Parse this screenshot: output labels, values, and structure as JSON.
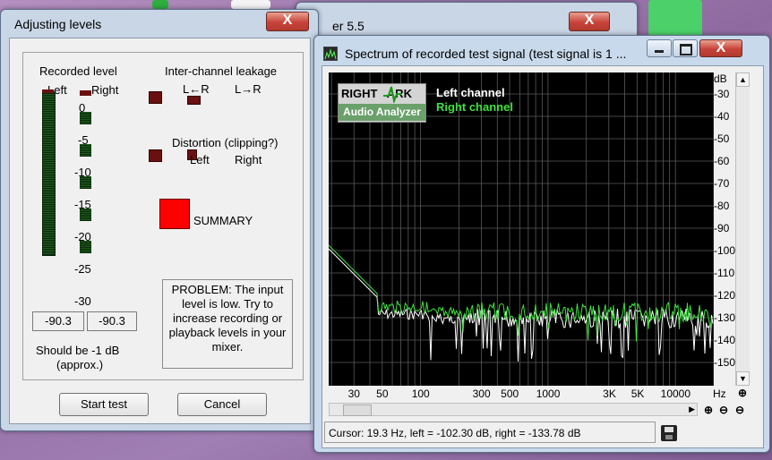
{
  "left_window": {
    "title": "Adjusting levels",
    "close_label": "X",
    "recorded_level": "Recorded level",
    "left": "Left",
    "right": "Right",
    "scale": [
      "0",
      "-5",
      "-10",
      "-15",
      "-20",
      "-25",
      "-30"
    ],
    "leakage_title": "Inter-channel leakage",
    "leakage_lr": "L←R",
    "leakage_rl": "L→R",
    "distortion_title": "Distortion (clipping?)",
    "dist_left": "Left",
    "dist_right": "Right",
    "summary": "SUMMARY",
    "summary_color": "#ff0000",
    "left_value": "-90.3",
    "right_value": "-90.3",
    "should_be": "Should be  -1 dB",
    "approx": "(approx.)",
    "problem": "PROBLEM: The input level is low. Try to increase recording or playback levels in your mixer.",
    "start_btn": "Start test",
    "cancel_btn": "Cancel"
  },
  "behind": {
    "partial_title": "er 5.5",
    "close_label": "X"
  },
  "spectrum_window": {
    "title": "Spectrum of recorded test signal (test signal is 1 ...",
    "close_label": "X",
    "logo_top": "RIGHT   ARK",
    "logo_bottom": "Audio Analyzer",
    "left_channel": "Left channel",
    "right_channel": "Right channel",
    "left_color": "#ffffff",
    "right_color": "#40e040",
    "db_unit": "dB",
    "db_ticks": [
      "-30",
      "-40",
      "-50",
      "-60",
      "-70",
      "-80",
      "-90",
      "-100",
      "-110",
      "-120",
      "-130",
      "-140",
      "-150"
    ],
    "hz_ticks": [
      "30",
      "50",
      "100",
      "300",
      "500",
      "1000",
      "3K",
      "5K",
      "10000"
    ],
    "hz_unit": "Hz",
    "cursor_text": "Cursor:  19.3 Hz,  left = -102.30 dB,  right = -133.78 dB"
  }
}
